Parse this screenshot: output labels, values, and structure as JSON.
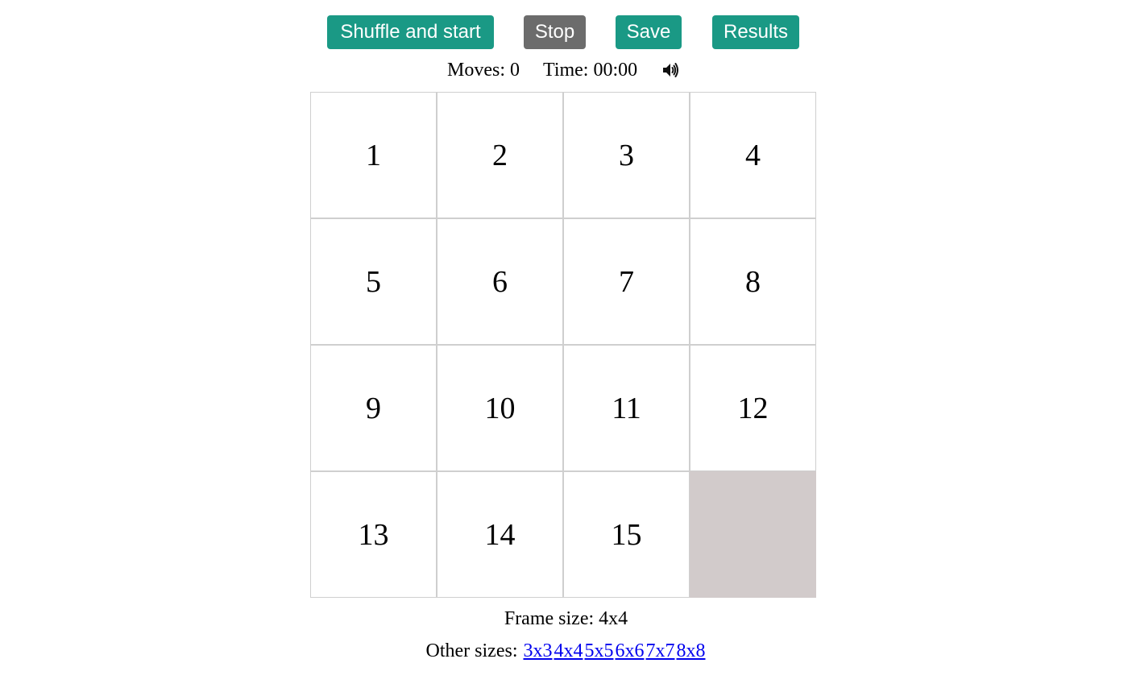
{
  "toolbar": {
    "shuffle_label": "Shuffle and start",
    "stop_label": "Stop",
    "save_label": "Save",
    "results_label": "Results"
  },
  "colors": {
    "button_green": "#1a9985",
    "button_gray": "#6c6c6c",
    "empty_cell": "#d2cbcb",
    "link": "#0000ee"
  },
  "stats": {
    "moves": "Moves: 0",
    "time": "Time: 00:00",
    "sound_icon": "speaker-volume-icon"
  },
  "board": {
    "rows": 4,
    "cols": 4,
    "tiles": [
      "1",
      "2",
      "3",
      "4",
      "5",
      "6",
      "7",
      "8",
      "9",
      "10",
      "11",
      "12",
      "13",
      "14",
      "15",
      ""
    ]
  },
  "footer": {
    "frame_size": "Frame size: 4x4",
    "other_sizes_label": "Other sizes:",
    "sizes": [
      "3x3",
      "4x4",
      "5x5",
      "6x6",
      "7x7",
      "8x8"
    ]
  }
}
